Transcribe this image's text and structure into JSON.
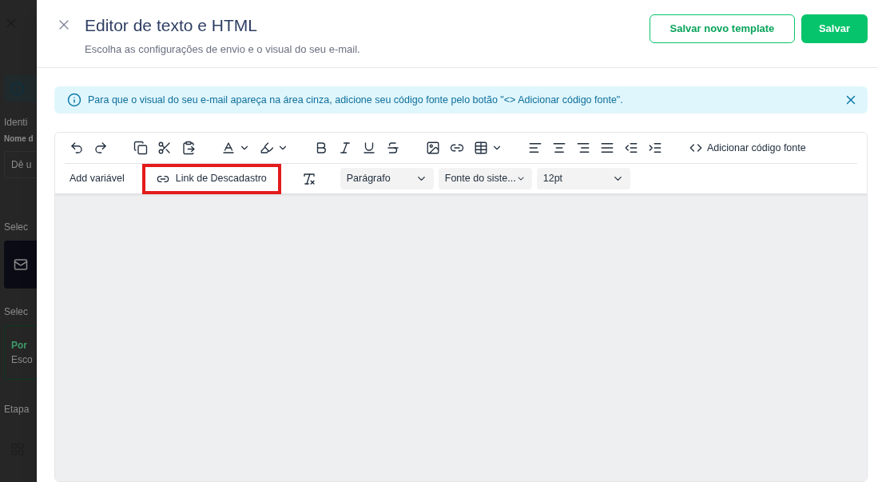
{
  "background_page": {
    "section_title": "Identi",
    "field_label": "Nome d",
    "field_placeholder": "Dê u",
    "channel_title": "Selec",
    "template_title": "Selec",
    "template_card": {
      "title": "Por",
      "subtitle": "Esco",
      "selected": true
    },
    "steps_title": "Etapa"
  },
  "drawer": {
    "title": "Editor de texto e HTML",
    "subtitle": "Escolha as configurações de envio e o visual do seu e-mail.",
    "buttons": [
      {
        "label": "Salvar novo template",
        "kind": "outline"
      },
      {
        "label": "Salvar",
        "kind": "primary"
      }
    ]
  },
  "alert": {
    "text": "Para que o visual do seu e-mail apareça na área cinza, adicione seu código fonte pelo botão \"<> Adicionar código fonte\"."
  },
  "toolbar": {
    "source_button": "Adicionar código fonte",
    "add_variable": "Add variável",
    "unsubscribe_link": {
      "label": "Link de Descadastro",
      "highlighted": true
    },
    "selects": [
      {
        "value": "Parágrafo",
        "kind": "wide"
      },
      {
        "value": "Fonte do siste...",
        "kind": "wide"
      },
      {
        "value": "12pt",
        "kind": "wide"
      }
    ]
  }
}
